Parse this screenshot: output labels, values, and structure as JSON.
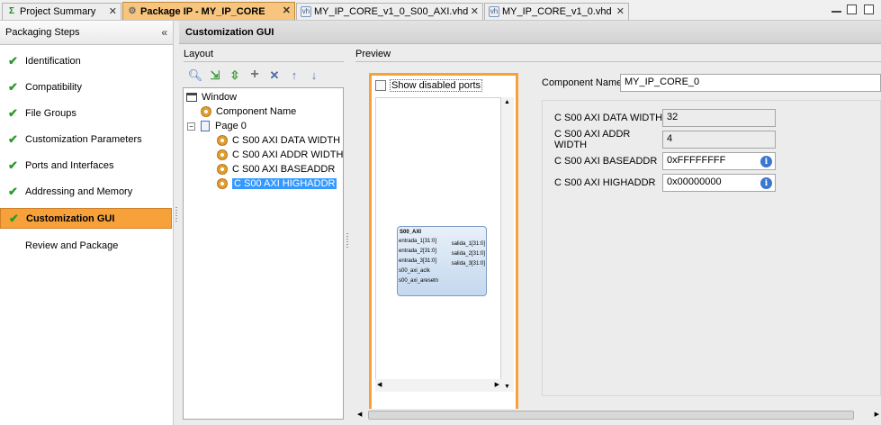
{
  "tabs": [
    {
      "label": "Project Summary",
      "icon": "sigma-icon"
    },
    {
      "label": "Package IP - MY_IP_CORE",
      "icon": "package-icon"
    },
    {
      "label": "MY_IP_CORE_v1_0_S00_AXI.vhd",
      "icon": "vhdl-file-icon"
    },
    {
      "label": "MY_IP_CORE_v1_0.vhd",
      "icon": "vhdl-file-icon"
    }
  ],
  "left_panel": {
    "title": "Packaging Steps",
    "steps": [
      {
        "label": "Identification",
        "done": true
      },
      {
        "label": "Compatibility",
        "done": true
      },
      {
        "label": "File Groups",
        "done": true
      },
      {
        "label": "Customization Parameters",
        "done": true
      },
      {
        "label": "Ports and Interfaces",
        "done": true
      },
      {
        "label": "Addressing and Memory",
        "done": true
      },
      {
        "label": "Customization GUI",
        "done": true,
        "active": true
      },
      {
        "label": "Review and Package",
        "done": false
      }
    ]
  },
  "main": {
    "title": "Customization GUI",
    "layout_label": "Layout",
    "preview_label": "Preview",
    "tree": {
      "window": "Window",
      "component_name": "Component Name",
      "page": "Page 0",
      "params": [
        "C S00 AXI DATA WIDTH",
        "C S00 AXI ADDR WIDTH",
        "C S00 AXI BASEADDR",
        "C S00 AXI HIGHADDR"
      ]
    },
    "preview": {
      "show_disabled_ports": "Show disabled ports",
      "block": {
        "bus": "S00_AXI",
        "inputs": [
          "entrada_1[31:0]",
          "entrada_2[31:0]",
          "entrada_3[31:0]",
          "s00_axi_aclk",
          "s00_axi_aresetn"
        ],
        "outputs": [
          "salida_1[31:0]",
          "salida_2[31:0]",
          "salida_3[31:0]"
        ]
      }
    },
    "form": {
      "component_name_label": "Component Name",
      "component_name_value": "MY_IP_CORE_0",
      "params": [
        {
          "label": "C S00 AXI DATA WIDTH",
          "value": "32"
        },
        {
          "label": "C S00 AXI ADDR WIDTH",
          "value": "4"
        },
        {
          "label": "C S00 AXI BASEADDR",
          "value": "0xFFFFFFFF"
        },
        {
          "label": "C S00 AXI HIGHADDR",
          "value": "0x00000000"
        }
      ]
    }
  },
  "colors": {
    "accent": "#f6a13a",
    "check": "#2a9a2a",
    "selection": "#3399ff"
  }
}
